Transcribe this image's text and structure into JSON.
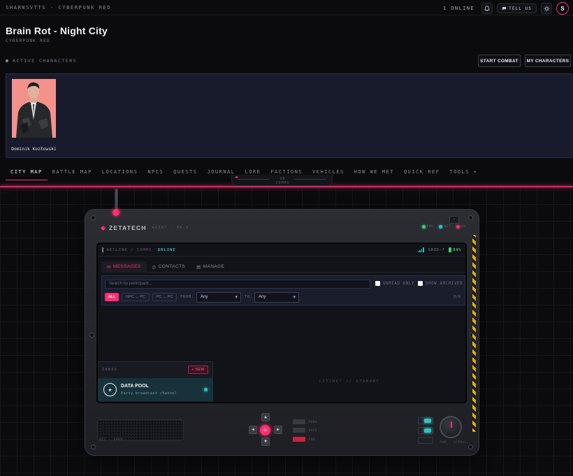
{
  "topbar": {
    "brand": "SHARNSVTTS · CYBERPUNK RED",
    "online": "1 ONLINE",
    "tell_us": "TELL US",
    "avatar_initial": "S"
  },
  "header": {
    "title": "Brain Rot - Night City",
    "subtitle": "CYBERPUNK RED",
    "active_label": "ACTIVE CHARACTERS",
    "start_combat": "START COMBAT",
    "my_characters": "MY CHARACTERS"
  },
  "characters": [
    {
      "name": "Dominik Kozłowski"
    }
  ],
  "tabs": [
    "CITY MAP",
    "BATTLE MAP",
    "LOCATIONS",
    "NPCS",
    "QUESTS",
    "JOURNAL",
    "LORE",
    "FACTIONS",
    "VEHICLES",
    "HOW WE MET",
    "QUICK REF",
    "TOOLS ▾"
  ],
  "active_tab": "CITY MAP",
  "handle_label": "OR\nCOMMS",
  "device": {
    "brand": "ZETATECH",
    "model": "AGENT · MK-V",
    "leds": [
      "PWR",
      "NET",
      "RX"
    ],
    "minimize": "-",
    "screen": {
      "path": "NETLINK / COMMS · ",
      "status": "ONLINE",
      "grid": "GRID-7",
      "battery": "84%",
      "tabs": [
        "MESSAGES",
        "CONTACTS",
        "MANAGE"
      ],
      "search_placeholder": "Search by participant...",
      "unread_only": "UNREAD ONLY",
      "show_archived": "SHOW ARCHIVED",
      "filter_all": "ALL",
      "filter_npc": "NPC ↔ PC",
      "filter_pc": "PC ↔ PC",
      "from_label": "FROM:",
      "from_value": "Any",
      "to_label": "TO:",
      "to_value": "Any",
      "count": "0/0",
      "inbox_label": "INBOX",
      "new_button": "+ NEW",
      "channel_name": "DATA POOL",
      "channel_desc": "Party broadcast channel",
      "standby": "◦ CITINET // STANDBY"
    },
    "speaker_label": "MIC · SPKR",
    "dpad_ok": "OK",
    "menu_buttons": [
      "MENU",
      "BACK",
      "END"
    ],
    "knob_label": "PWR · SCROLL"
  },
  "colors": {
    "accent": "#ff2e6e",
    "cyan": "#2ec4c4",
    "panel": "#171b2c"
  }
}
